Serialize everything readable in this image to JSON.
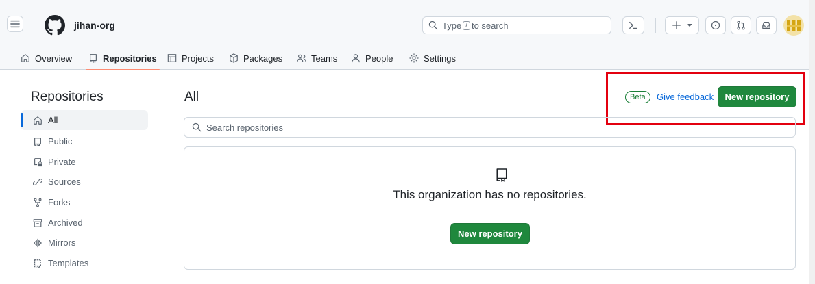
{
  "header": {
    "org_name": "jihan-org",
    "search": {
      "prefix": "Type",
      "key": "/",
      "suffix": "to search"
    },
    "icons": [
      "menu-icon",
      "github-logo-icon",
      "search-icon",
      "command-palette-icon",
      "plus-icon",
      "caret-down-icon",
      "issue-opened-icon",
      "git-pull-request-icon",
      "inbox-icon",
      "avatar"
    ]
  },
  "tabs": [
    {
      "label": "Overview",
      "icon": "home-icon"
    },
    {
      "label": "Repositories",
      "icon": "repo-icon",
      "active": true
    },
    {
      "label": "Projects",
      "icon": "table-icon"
    },
    {
      "label": "Packages",
      "icon": "package-icon"
    },
    {
      "label": "Teams",
      "icon": "people-icon"
    },
    {
      "label": "People",
      "icon": "person-icon"
    },
    {
      "label": "Settings",
      "icon": "gear-icon"
    }
  ],
  "sidebar": {
    "title": "Repositories",
    "items": [
      {
        "label": "All",
        "icon": "home-icon",
        "active": true
      },
      {
        "label": "Public",
        "icon": "repo-icon"
      },
      {
        "label": "Private",
        "icon": "repo-locked-icon"
      },
      {
        "label": "Sources",
        "icon": "link-icon"
      },
      {
        "label": "Forks",
        "icon": "repo-forked-icon"
      },
      {
        "label": "Archived",
        "icon": "archive-icon"
      },
      {
        "label": "Mirrors",
        "icon": "mirror-icon"
      },
      {
        "label": "Templates",
        "icon": "repo-template-icon"
      }
    ]
  },
  "main": {
    "title": "All",
    "beta_label": "Beta",
    "feedback_label": "Give feedback",
    "new_repo_label": "New repository",
    "search_placeholder": "Search repositories",
    "empty_message": "This organization has no repositories.",
    "empty_button_label": "New repository"
  },
  "colors": {
    "accent_green": "#1f883d",
    "link_blue": "#0969da",
    "active_tab_underline": "#fd8c73",
    "highlight_box": "#e3000f"
  }
}
